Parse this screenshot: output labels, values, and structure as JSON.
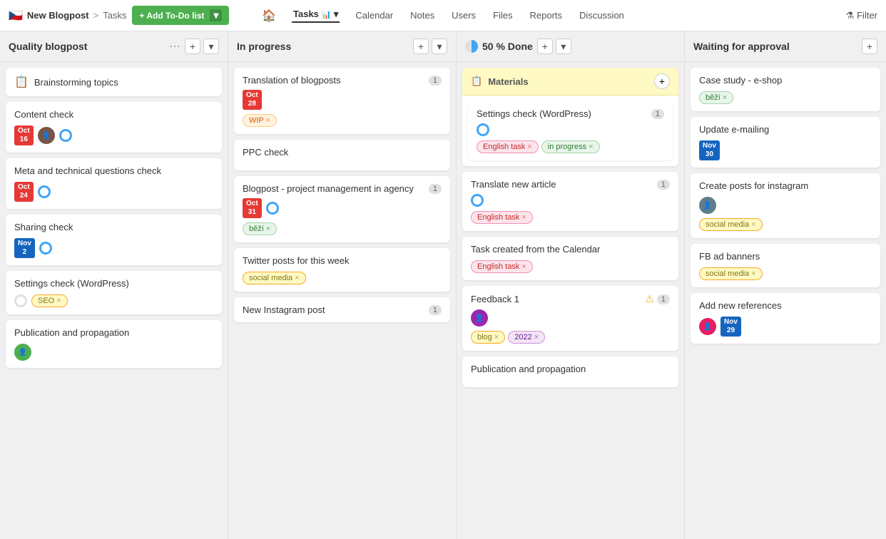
{
  "nav": {
    "flag": "🇨🇿",
    "project": "New Blogpost",
    "sep": ">",
    "breadcrumb": "Tasks",
    "add_btn": "+ Add To-Do list",
    "home_icon": "🏠",
    "tabs": [
      {
        "label": "Tasks",
        "active": true
      },
      {
        "label": "Calendar"
      },
      {
        "label": "Notes"
      },
      {
        "label": "Users"
      },
      {
        "label": "Files"
      },
      {
        "label": "Reports"
      },
      {
        "label": "Discussion"
      }
    ],
    "filter": "Filter"
  },
  "columns": {
    "quality": {
      "title": "Quality blogpost",
      "cards": [
        {
          "id": "brainstorming",
          "icon": "📋",
          "title": "Brainstorming topics"
        },
        {
          "id": "content-check",
          "title": "Content check",
          "date": "Oct\n16",
          "date_type": "oct",
          "has_avatar": true,
          "has_circle": true
        },
        {
          "id": "meta-check",
          "title": "Meta and technical questions check",
          "date": "Oct\n24",
          "date_type": "oct",
          "has_circle": true
        },
        {
          "id": "sharing-check",
          "title": "Sharing check",
          "date": "Nov\n2",
          "date_type": "nov",
          "has_circle": true
        },
        {
          "id": "settings-wp",
          "title": "Settings check (WordPress)",
          "has_circle": true,
          "tags": [
            {
              "label": "SEO",
              "type": "seo"
            }
          ]
        },
        {
          "id": "publication",
          "title": "Publication and propagation",
          "has_avatar2": true
        }
      ]
    },
    "in_progress": {
      "title": "In progress",
      "cards": [
        {
          "id": "translation-blogposts",
          "title": "Translation of blogposts",
          "count": 1,
          "date": "Oct\n28",
          "date_type": "oct",
          "tags": [
            {
              "label": "WIP",
              "type": "wip"
            }
          ]
        },
        {
          "id": "ppc-check",
          "title": "PPC check"
        },
        {
          "id": "blogpost-project",
          "title": "Blogpost - project management in agency",
          "count": 1,
          "date": "Oct\n31",
          "date_type": "oct",
          "has_circle": true,
          "tags": [
            {
              "label": "běží",
              "type": "bezi"
            }
          ]
        },
        {
          "id": "twitter-posts",
          "title": "Twitter posts for this week",
          "tags": [
            {
              "label": "social media",
              "type": "social"
            }
          ]
        },
        {
          "id": "new-instagram",
          "title": "New Instagram post",
          "count": 1
        }
      ]
    },
    "done50": {
      "title": "50 % Done",
      "cards_materials": true,
      "cards": [
        {
          "id": "settings-wp-done",
          "title": "Settings check (WordPress)",
          "count": 1,
          "has_circle": true,
          "tags": [
            {
              "label": "English task",
              "type": "english"
            },
            {
              "label": "in progress",
              "type": "in-progress"
            }
          ]
        },
        {
          "id": "translate-article",
          "title": "Translate new article",
          "count": 1,
          "has_circle": true,
          "tags": [
            {
              "label": "English task",
              "type": "english"
            }
          ]
        },
        {
          "id": "task-calendar",
          "title": "Task created from the Calendar",
          "tags": [
            {
              "label": "English task",
              "type": "english"
            }
          ]
        },
        {
          "id": "feedback1",
          "title": "Feedback 1",
          "count": 1,
          "has_warn": true,
          "has_avatar3": true,
          "tags": [
            {
              "label": "blog",
              "type": "blog"
            },
            {
              "label": "2022",
              "type": "t2022"
            }
          ]
        },
        {
          "id": "pub-prop",
          "title": "Publication and propagation"
        }
      ]
    },
    "waiting": {
      "title": "Waiting for approval",
      "cards": [
        {
          "id": "case-study",
          "title": "Case study - e-shop",
          "tags": [
            {
              "label": "běží",
              "type": "bezi"
            }
          ]
        },
        {
          "id": "update-emailing",
          "title": "Update e-mailing",
          "date": "Nov\n30",
          "date_type": "nov"
        },
        {
          "id": "create-instagram",
          "title": "Create posts for instagram",
          "has_avatar4": true,
          "tags": [
            {
              "label": "social media",
              "type": "social"
            }
          ]
        },
        {
          "id": "fb-banners",
          "title": "FB ad banners",
          "tags": [
            {
              "label": "social media",
              "type": "social"
            }
          ]
        },
        {
          "id": "add-references",
          "title": "Add new references",
          "has_avatar5": true,
          "has_date_nov29": true
        }
      ]
    }
  }
}
